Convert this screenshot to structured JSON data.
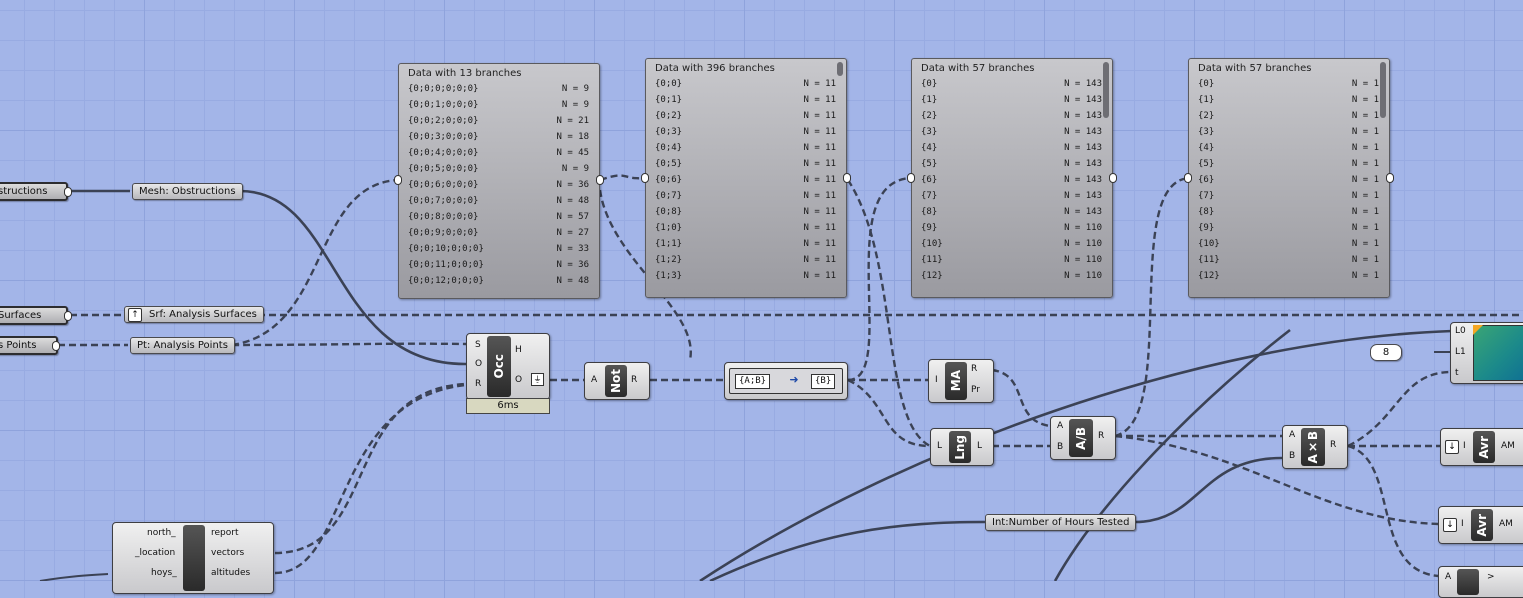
{
  "colors": {
    "canvas": "#a3b5e8",
    "wire": "#3b4255",
    "panel": "#a8a8ae",
    "gradient_start": "#2e9e6a",
    "gradient_end": "#0c6e9c"
  },
  "params": {
    "obstructions_out": "structions",
    "mesh_obstructions": "Mesh: Obstructions",
    "surfaces_out": "Surfaces",
    "srf_analysis": "Srf: Analysis Surfaces",
    "points_out": "s Points",
    "pt_analysis": "Pt: Analysis Points",
    "int_hours": "Int:Number of Hours Tested",
    "number_value": "8"
  },
  "panels": [
    {
      "title": "Data with 13 branches",
      "rows": [
        {
          "path": "{0;0;0;0;0;0}",
          "n": "N = 9"
        },
        {
          "path": "{0;0;1;0;0;0}",
          "n": "N = 9"
        },
        {
          "path": "{0;0;2;0;0;0}",
          "n": "N = 21"
        },
        {
          "path": "{0;0;3;0;0;0}",
          "n": "N = 18"
        },
        {
          "path": "{0;0;4;0;0;0}",
          "n": "N = 45"
        },
        {
          "path": "{0;0;5;0;0;0}",
          "n": "N = 9"
        },
        {
          "path": "{0;0;6;0;0;0}",
          "n": "N = 36"
        },
        {
          "path": "{0;0;7;0;0;0}",
          "n": "N = 48"
        },
        {
          "path": "{0;0;8;0;0;0}",
          "n": "N = 57"
        },
        {
          "path": "{0;0;9;0;0;0}",
          "n": "N = 27"
        },
        {
          "path": "{0;0;10;0;0;0}",
          "n": "N = 33"
        },
        {
          "path": "{0;0;11;0;0;0}",
          "n": "N = 36"
        },
        {
          "path": "{0;0;12;0;0;0}",
          "n": "N = 48"
        }
      ]
    },
    {
      "title": "Data with 396 branches",
      "rows": [
        {
          "path": "{0;0}",
          "n": "N = 11"
        },
        {
          "path": "{0;1}",
          "n": "N = 11"
        },
        {
          "path": "{0;2}",
          "n": "N = 11"
        },
        {
          "path": "{0;3}",
          "n": "N = 11"
        },
        {
          "path": "{0;4}",
          "n": "N = 11"
        },
        {
          "path": "{0;5}",
          "n": "N = 11"
        },
        {
          "path": "{0;6}",
          "n": "N = 11"
        },
        {
          "path": "{0;7}",
          "n": "N = 11"
        },
        {
          "path": "{0;8}",
          "n": "N = 11"
        },
        {
          "path": "{1;0}",
          "n": "N = 11"
        },
        {
          "path": "{1;1}",
          "n": "N = 11"
        },
        {
          "path": "{1;2}",
          "n": "N = 11"
        },
        {
          "path": "{1;3}",
          "n": "N = 11"
        }
      ]
    },
    {
      "title": "Data with 57 branches",
      "rows": [
        {
          "path": "{0}",
          "n": "N = 143"
        },
        {
          "path": "{1}",
          "n": "N = 143"
        },
        {
          "path": "{2}",
          "n": "N = 143"
        },
        {
          "path": "{3}",
          "n": "N = 143"
        },
        {
          "path": "{4}",
          "n": "N = 143"
        },
        {
          "path": "{5}",
          "n": "N = 143"
        },
        {
          "path": "{6}",
          "n": "N = 143"
        },
        {
          "path": "{7}",
          "n": "N = 143"
        },
        {
          "path": "{8}",
          "n": "N = 143"
        },
        {
          "path": "{9}",
          "n": "N = 110"
        },
        {
          "path": "{10}",
          "n": "N = 110"
        },
        {
          "path": "{11}",
          "n": "N = 110"
        },
        {
          "path": "{12}",
          "n": "N = 110"
        }
      ]
    },
    {
      "title": "Data with 57 branches",
      "rows": [
        {
          "path": "{0}",
          "n": "N = 1"
        },
        {
          "path": "{1}",
          "n": "N = 1"
        },
        {
          "path": "{2}",
          "n": "N = 1"
        },
        {
          "path": "{3}",
          "n": "N = 1"
        },
        {
          "path": "{4}",
          "n": "N = 1"
        },
        {
          "path": "{5}",
          "n": "N = 1"
        },
        {
          "path": "{6}",
          "n": "N = 1"
        },
        {
          "path": "{7}",
          "n": "N = 1"
        },
        {
          "path": "{8}",
          "n": "N = 1"
        },
        {
          "path": "{9}",
          "n": "N = 1"
        },
        {
          "path": "{10}",
          "n": "N = 1"
        },
        {
          "path": "{11}",
          "n": "N = 1"
        },
        {
          "path": "{12}",
          "n": "N = 1"
        }
      ]
    }
  ],
  "occ": {
    "label": "Occ",
    "in": [
      "S",
      "O",
      "R"
    ],
    "out": [
      "H",
      "O"
    ],
    "time": "6ms"
  },
  "not": {
    "label": "Not",
    "in": "A",
    "out": "R"
  },
  "expr": {
    "left": "{A;B}",
    "right": "{B}"
  },
  "ma": {
    "label": "MA",
    "in": "I",
    "out": [
      "R",
      "Pr"
    ]
  },
  "lng": {
    "label": "Lng",
    "in": "L",
    "out": "L"
  },
  "div": {
    "label": "A/B",
    "in": [
      "A",
      "B"
    ],
    "out": "R"
  },
  "mul": {
    "label": "A×B",
    "in": [
      "A",
      "B"
    ],
    "out": "R"
  },
  "avr1": {
    "label": "Avr",
    "in": "I",
    "out": "AM"
  },
  "avr2": {
    "label": "Avr",
    "in": "I",
    "out": "AM"
  },
  "gradient": {
    "inputs": [
      "L0",
      "L1",
      "t"
    ]
  },
  "sun": {
    "in": [
      "north_",
      "_location",
      "hoys_"
    ],
    "out": [
      "report",
      "vectors",
      "altitudes"
    ]
  },
  "bottom_comp": {
    "in": "A",
    "out": ">"
  }
}
